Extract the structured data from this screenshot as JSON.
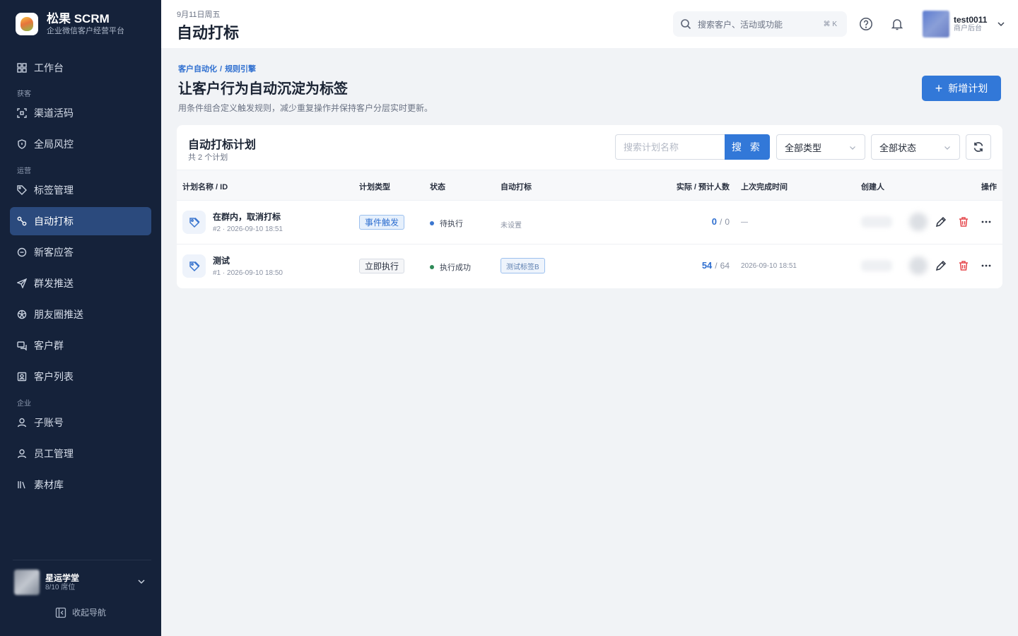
{
  "brand": {
    "title": "松果 SCRM",
    "subtitle": "企业微信客户经营平台"
  },
  "sidebar": {
    "items": [
      {
        "label": "工作台",
        "icon": "dashboard-icon"
      },
      {
        "group": "获客"
      },
      {
        "label": "渠道活码",
        "icon": "qrcode-icon"
      },
      {
        "label": "全局风控",
        "icon": "shield-icon"
      },
      {
        "group": "运营"
      },
      {
        "label": "标签管理",
        "icon": "tag-icon"
      },
      {
        "label": "自动打标",
        "icon": "auto-tag-icon",
        "active": true
      },
      {
        "label": "新客应答",
        "icon": "chat-icon"
      },
      {
        "label": "群发推送",
        "icon": "send-icon"
      },
      {
        "label": "朋友圈推送",
        "icon": "moments-icon"
      },
      {
        "label": "客户群",
        "icon": "group-chat-icon"
      },
      {
        "label": "客户列表",
        "icon": "contact-list-icon"
      },
      {
        "group": "企业"
      },
      {
        "label": "子账号",
        "icon": "user-icon"
      },
      {
        "label": "员工管理",
        "icon": "staff-icon"
      },
      {
        "label": "素材库",
        "icon": "library-icon"
      }
    ],
    "org": {
      "name": "星运学堂",
      "seats": "8/10 席位"
    },
    "collapse_label": "收起导航"
  },
  "header": {
    "date": "9月11日周五",
    "title": "自动打标",
    "search_placeholder": "搜索客户、活动或功能",
    "search_shortcut": "⌘ K",
    "user": {
      "name": "test0011",
      "role": "商户后台"
    }
  },
  "page": {
    "breadcrumb": [
      "客户自动化",
      "规则引擎"
    ],
    "headline": "让客户行为自动沉淀为标签",
    "description": "用条件组合定义触发规则，减少重复操作并保持客户分层实时更新。",
    "new_button": "新增计划"
  },
  "card": {
    "title": "自动打标计划",
    "count": "共 2 个计划",
    "search_placeholder": "搜索计划名称",
    "search_button": "搜 索",
    "type_filter": "全部类型",
    "status_filter": "全部状态",
    "columns": [
      "计划名称 / ID",
      "计划类型",
      "状态",
      "自动打标",
      "实际 / 预计人数",
      "上次完成时间",
      "创建人",
      "操作"
    ],
    "rows": [
      {
        "name": "在群内，取消打标",
        "meta": "#2 · 2026-09-10 18:51",
        "type": "事件触发",
        "status": "待执行",
        "status_color": "#3b76cf",
        "auto_tag": "未设置",
        "actual": "0",
        "planned": "0",
        "last_time": "—"
      },
      {
        "name": "测试",
        "meta": "#1 · 2026-09-10 18:50",
        "type": "立即执行",
        "status": "执行成功",
        "status_color": "#2e8a57",
        "auto_tag": "测试标签B",
        "actual": "54",
        "planned": "64",
        "last_time": "2026-09-10 18:51"
      }
    ]
  },
  "colors": {
    "primary": "#3278d8",
    "sidebar": "#15223a",
    "sidebar_active": "#2b4a7d",
    "danger": "#e5484d"
  }
}
